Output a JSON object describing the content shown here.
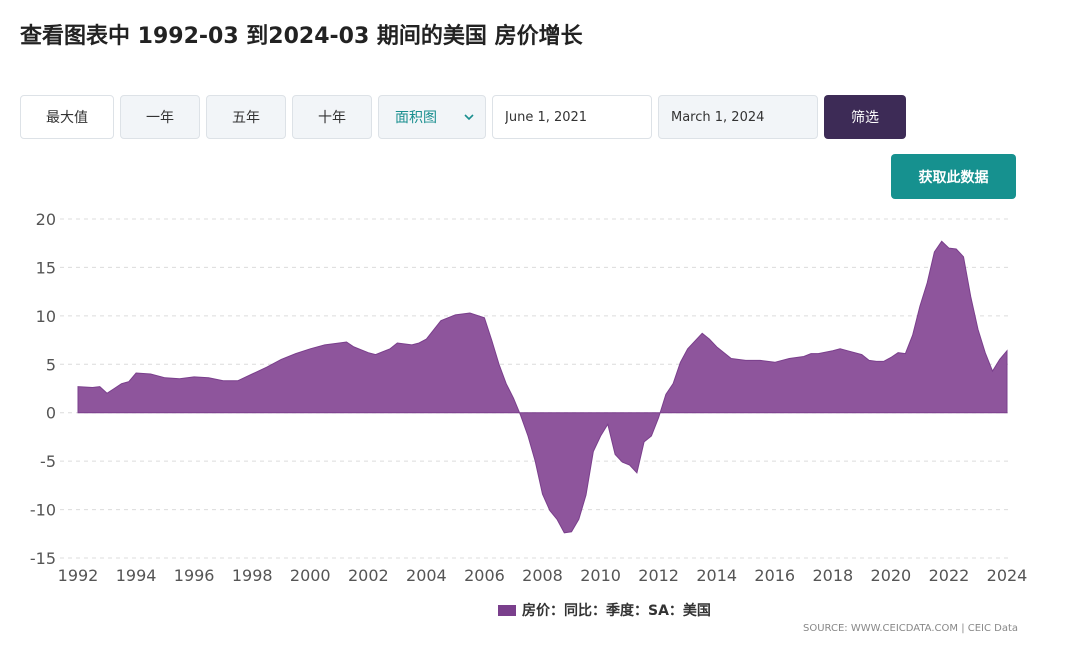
{
  "page": {
    "title": "查看图表中 1992-03 到2024-03 期间的美国 房价增长"
  },
  "toolbar": {
    "range_buttons": [
      "最大值",
      "一年",
      "五年",
      "十年"
    ],
    "chart_type": "面积图",
    "start_date": "June 1, 2021",
    "end_date": "March 1, 2024",
    "filter_label": "筛选"
  },
  "get_data_label": "获取此数据",
  "legend": {
    "label": "房价：同比：季度：SA：美国"
  },
  "source": "SOURCE: WWW.CEICDATA.COM | CEIC Data",
  "colors": {
    "area_fill": "#8e559c",
    "area_stroke": "#7a3f8c",
    "filter_button": "#3d2b56",
    "get_data_button": "#16918f",
    "accent_text": "#1a8f8f"
  },
  "chart_data": {
    "type": "area",
    "x_unit": "year",
    "xlim": [
      1992,
      2024
    ],
    "ylim": [
      -15,
      20
    ],
    "x_ticks": [
      1992,
      1994,
      1996,
      1998,
      2000,
      2002,
      2004,
      2006,
      2008,
      2010,
      2012,
      2014,
      2016,
      2018,
      2020,
      2022,
      2024
    ],
    "y_ticks": [
      -15,
      -10,
      -5,
      0,
      5,
      10,
      15,
      20
    ],
    "grid": "horizontal-dashed",
    "legend_position": "bottom",
    "series": [
      {
        "name": "房价：同比：季度：SA：美国",
        "points": [
          [
            1992.0,
            2.7
          ],
          [
            1992.5,
            2.6
          ],
          [
            1992.75,
            2.7
          ],
          [
            1993.0,
            2.0
          ],
          [
            1993.25,
            2.5
          ],
          [
            1993.5,
            3.0
          ],
          [
            1993.75,
            3.2
          ],
          [
            1994.0,
            4.1
          ],
          [
            1994.5,
            4.0
          ],
          [
            1995.0,
            3.6
          ],
          [
            1995.5,
            3.5
          ],
          [
            1996.0,
            3.7
          ],
          [
            1996.5,
            3.6
          ],
          [
            1997.0,
            3.3
          ],
          [
            1997.5,
            3.3
          ],
          [
            1998.0,
            4.0
          ],
          [
            1998.5,
            4.7
          ],
          [
            1999.0,
            5.5
          ],
          [
            1999.5,
            6.1
          ],
          [
            2000.0,
            6.6
          ],
          [
            2000.5,
            7.0
          ],
          [
            2001.0,
            7.2
          ],
          [
            2001.25,
            7.3
          ],
          [
            2001.5,
            6.8
          ],
          [
            2002.0,
            6.2
          ],
          [
            2002.25,
            6.0
          ],
          [
            2002.75,
            6.6
          ],
          [
            2003.0,
            7.2
          ],
          [
            2003.5,
            7.0
          ],
          [
            2003.75,
            7.2
          ],
          [
            2004.0,
            7.6
          ],
          [
            2004.5,
            9.5
          ],
          [
            2005.0,
            10.1
          ],
          [
            2005.5,
            10.3
          ],
          [
            2006.0,
            9.8
          ],
          [
            2006.25,
            7.5
          ],
          [
            2006.5,
            5.0
          ],
          [
            2006.75,
            3.0
          ],
          [
            2007.0,
            1.5
          ],
          [
            2007.25,
            -0.3
          ],
          [
            2007.5,
            -2.4
          ],
          [
            2007.75,
            -5.0
          ],
          [
            2008.0,
            -8.4
          ],
          [
            2008.25,
            -10.1
          ],
          [
            2008.5,
            -11.0
          ],
          [
            2008.75,
            -12.4
          ],
          [
            2009.0,
            -12.3
          ],
          [
            2009.25,
            -11.0
          ],
          [
            2009.5,
            -8.5
          ],
          [
            2009.75,
            -4.0
          ],
          [
            2010.0,
            -2.4
          ],
          [
            2010.25,
            -1.2
          ],
          [
            2010.5,
            -4.3
          ],
          [
            2010.75,
            -5.1
          ],
          [
            2011.0,
            -5.4
          ],
          [
            2011.25,
            -6.2
          ],
          [
            2011.5,
            -3.0
          ],
          [
            2011.75,
            -2.4
          ],
          [
            2012.0,
            -0.5
          ],
          [
            2012.25,
            1.9
          ],
          [
            2012.5,
            3.0
          ],
          [
            2012.75,
            5.2
          ],
          [
            2013.0,
            6.6
          ],
          [
            2013.5,
            8.2
          ],
          [
            2013.75,
            7.6
          ],
          [
            2014.0,
            6.8
          ],
          [
            2014.5,
            5.6
          ],
          [
            2015.0,
            5.4
          ],
          [
            2015.5,
            5.4
          ],
          [
            2016.0,
            5.2
          ],
          [
            2016.5,
            5.6
          ],
          [
            2017.0,
            5.8
          ],
          [
            2017.25,
            6.1
          ],
          [
            2017.5,
            6.1
          ],
          [
            2018.0,
            6.4
          ],
          [
            2018.25,
            6.6
          ],
          [
            2018.5,
            6.4
          ],
          [
            2019.0,
            6.0
          ],
          [
            2019.25,
            5.4
          ],
          [
            2019.5,
            5.3
          ],
          [
            2019.75,
            5.3
          ],
          [
            2020.0,
            5.7
          ],
          [
            2020.25,
            6.2
          ],
          [
            2020.5,
            6.1
          ],
          [
            2020.75,
            8.0
          ],
          [
            2021.0,
            11.0
          ],
          [
            2021.25,
            13.4
          ],
          [
            2021.5,
            16.6
          ],
          [
            2021.75,
            17.7
          ],
          [
            2022.0,
            17.0
          ],
          [
            2022.25,
            16.9
          ],
          [
            2022.5,
            16.1
          ],
          [
            2022.75,
            12.0
          ],
          [
            2023.0,
            8.6
          ],
          [
            2023.25,
            6.2
          ],
          [
            2023.5,
            4.3
          ],
          [
            2023.75,
            5.5
          ],
          [
            2024.0,
            6.4
          ]
        ]
      }
    ]
  }
}
